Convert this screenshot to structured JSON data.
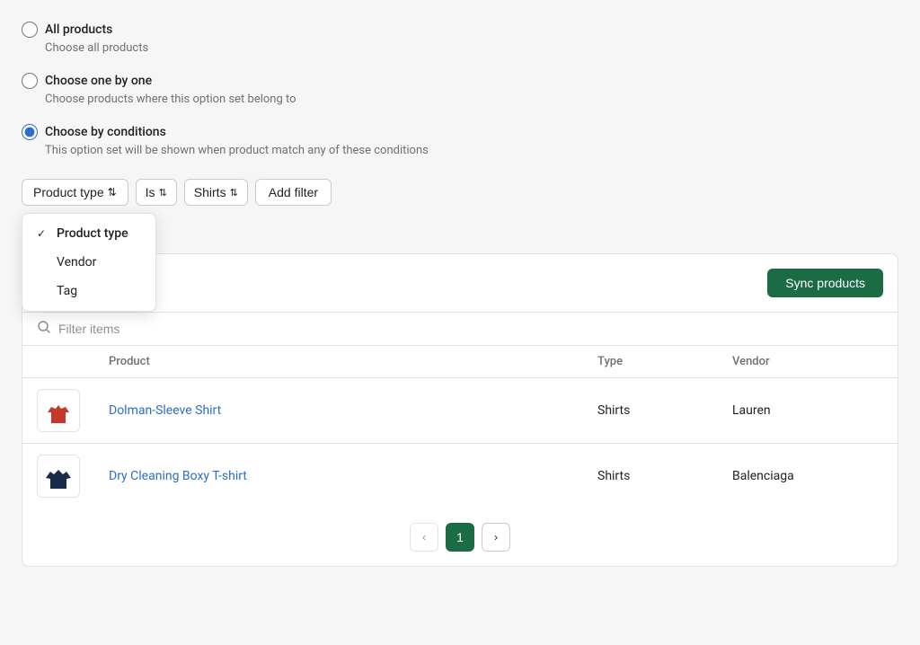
{
  "radio_options": [
    {
      "id": "all",
      "label": "All products",
      "description": "Choose all products",
      "checked": false
    },
    {
      "id": "one",
      "label": "Choose one by one",
      "description": "Choose products where this option set belong to",
      "checked": false
    },
    {
      "id": "conditions",
      "label": "Choose by conditions",
      "description": "This option set will be shown when product match any of these conditions",
      "checked": true
    }
  ],
  "filter": {
    "type_btn_label": "Product type",
    "dropdown_items": [
      {
        "label": "Product type",
        "active": true
      },
      {
        "label": "Vendor",
        "active": false
      },
      {
        "label": "Tag",
        "active": false
      }
    ],
    "is_select_label": "Is",
    "value_select_label": "Shirts",
    "add_filter_label": "Add filter",
    "active_tag_label": "Shirts",
    "active_tag_remove": "×"
  },
  "table": {
    "sync_btn_label": "Sync products",
    "search_placeholder": "Filter items",
    "columns": [
      "",
      "Product",
      "Type",
      "Vendor"
    ],
    "rows": [
      {
        "id": 1,
        "product_name": "Dolman-Sleeve Shirt",
        "type": "Shirts",
        "vendor": "Lauren",
        "thumb_color": "#c0392b",
        "shirt_type": "red"
      },
      {
        "id": 2,
        "product_name": "Dry Cleaning Boxy T-shirt",
        "type": "Shirts",
        "vendor": "Balenciaga",
        "thumb_color": "#1a2b4a",
        "shirt_type": "navy"
      }
    ],
    "pagination": {
      "prev_label": "‹",
      "next_label": "›",
      "current_page": 1,
      "pages": [
        1
      ]
    }
  }
}
